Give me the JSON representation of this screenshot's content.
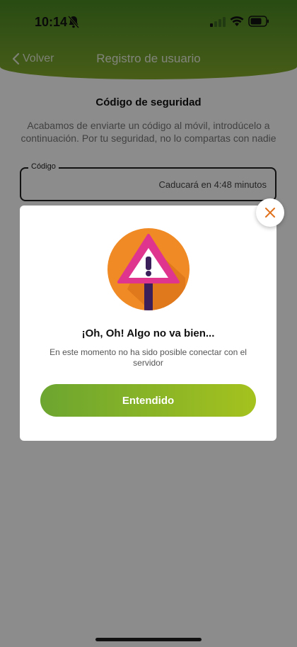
{
  "status_bar": {
    "time": "10:14",
    "icons": [
      "bell-slash-icon",
      "signal-icon",
      "wifi-icon",
      "battery-icon"
    ]
  },
  "nav": {
    "back_label": "Volver",
    "title": "Registro de usuario"
  },
  "page": {
    "title": "Código de seguridad",
    "description": "Acabamos de enviarte un código al móvil, introdúcelo a continuación. Por tu seguridad, no lo compartas con nadie",
    "code_field": {
      "label": "Código",
      "expiry_text": "Caducará en 4:48 minutos"
    }
  },
  "modal": {
    "icon": "warning-sign-icon",
    "title": "¡Oh, Oh! Algo no va bien...",
    "message": "En este momento no ha sido posible conectar con el servidor",
    "button_label": "Entendido",
    "close_icon": "close-icon"
  },
  "colors": {
    "brand_green": "#6c9c2a",
    "accent_orange": "#f08a24",
    "warning_pink": "#e0358f",
    "sign_post": "#3a1f5a"
  }
}
